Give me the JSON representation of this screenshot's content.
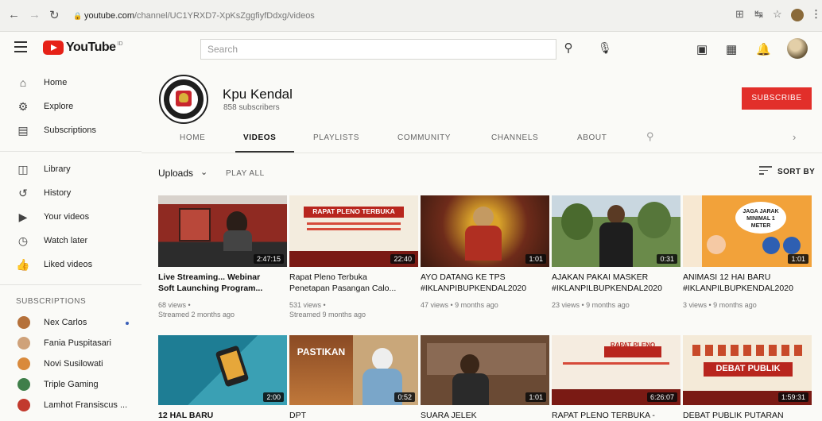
{
  "browser": {
    "url": "youtube.com/channel/UC1YRXD7-XpKsZggfiyfDdxg/videos",
    "url_domain": "youtube.com",
    "url_path": "/channel/UC1YRXD7-XpKsZggfiyfDdxg/videos"
  },
  "header": {
    "logo_text": "YouTube",
    "logo_suffix": "ID",
    "search_placeholder": "Search"
  },
  "sidebar": {
    "items": [
      {
        "label": "Home",
        "icon": "home-icon"
      },
      {
        "label": "Explore",
        "icon": "compass-icon"
      },
      {
        "label": "Subscriptions",
        "icon": "subscriptions-icon"
      },
      {
        "label": "Library",
        "icon": "library-icon"
      },
      {
        "label": "History",
        "icon": "history-icon"
      },
      {
        "label": "Your videos",
        "icon": "play-square-icon"
      },
      {
        "label": "Watch later",
        "icon": "clock-icon"
      },
      {
        "label": "Liked videos",
        "icon": "thumbs-up-icon"
      }
    ],
    "subscriptions_heading": "SUBSCRIPTIONS",
    "subscriptions": [
      {
        "label": "Nex Carlos",
        "color": "#b5713a",
        "new": true
      },
      {
        "label": "Fania Puspitasari",
        "color": "#cfa27a",
        "new": false
      },
      {
        "label": "Novi Susilowati",
        "color": "#d98a3c",
        "new": false
      },
      {
        "label": "Triple Gaming",
        "color": "#3f7f4a",
        "new": false
      },
      {
        "label": "Lamhot Fransiscus ...",
        "color": "#c23a2e",
        "new": false
      }
    ]
  },
  "channel": {
    "name": "Kpu Kendal",
    "subscribers": "858 subscribers",
    "subscribe_label": "SUBSCRIBE",
    "accent": "#e22f2a"
  },
  "tabs": [
    "HOME",
    "VIDEOS",
    "PLAYLISTS",
    "COMMUNITY",
    "CHANNELS",
    "ABOUT"
  ],
  "active_tab": "VIDEOS",
  "controls": {
    "uploads_label": "Uploads",
    "play_all": "PLAY ALL",
    "sort_by": "SORT BY"
  },
  "videos_row1": [
    {
      "title_line1": "Live Streaming... Webinar",
      "title_line2": "Soft Launching Program...",
      "views": "68 views •",
      "time": "Streamed 2 months ago",
      "duration": "2:47:15"
    },
    {
      "title_line1": "Rapat Pleno Terbuka",
      "title_line2": "Penetapan Pasangan Calo...",
      "views": "531 views •",
      "time": "Streamed 9 months ago",
      "duration": "22:40",
      "overlay": "RAPAT PLENO TERBUKA"
    },
    {
      "title_line1": "AYO DATANG KE TPS",
      "title_line2": "#IKLANPIBUPKENDAL2020",
      "views": "47 views • 9 months ago",
      "time": "",
      "duration": "1:01"
    },
    {
      "title_line1": "AJAKAN PAKAI MASKER",
      "title_line2": "#IKLANPILBUPKENDAL2020",
      "views": "23 views • 9 months ago",
      "time": "",
      "duration": "0:31"
    },
    {
      "title_line1": "ANIMASI 12 HAI BARU",
      "title_line2": "#IKLANPILBUPKENDAL2020",
      "views": "3 views • 9 months ago",
      "time": "",
      "duration": "1:01",
      "overlay": "JAGA JARAK MINIMAL 1 METER"
    }
  ],
  "videos_row2": [
    {
      "title_line1": "12 HAL BARU",
      "duration": "2:00"
    },
    {
      "title_line1": "DPT",
      "duration": "0:52",
      "overlay": "PASTIKAN"
    },
    {
      "title_line1": "SUARA JELEK",
      "duration": "1:01"
    },
    {
      "title_line1": "RAPAT PLENO TERBUKA -",
      "duration": "6:26:07",
      "overlay": "RAPAT PLENO TERBUKA"
    },
    {
      "title_line1": "DEBAT PUBLIK PUTARAN",
      "duration": "1:59:31",
      "overlay": "DEBAT PUBLIK"
    }
  ]
}
